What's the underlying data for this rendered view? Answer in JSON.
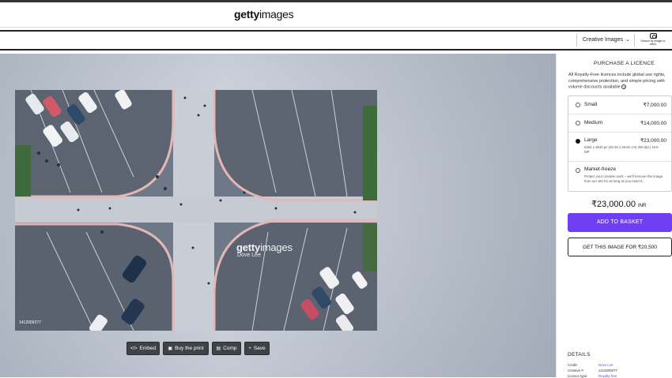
{
  "brand": {
    "logo_bold": "getty",
    "logo_rest": "images"
  },
  "search": {
    "value": "",
    "placeholder": ""
  },
  "nav": {
    "creative_dropdown": "Creative Images",
    "search_by_image": "Search by image or video"
  },
  "photo": {
    "id_text": "1412009277",
    "watermark_bold": "getty",
    "watermark_rest": "images",
    "watermark_credit": "Dove Lee"
  },
  "actions": [
    {
      "label": "Embed",
      "icon": "code-icon"
    },
    {
      "label": "Buy the print",
      "icon": "image-icon"
    },
    {
      "label": "Comp",
      "icon": "save-icon"
    },
    {
      "label": "Save",
      "icon": "plus-icon"
    }
  ],
  "licence": {
    "title": "PURCHASE A LICENCE",
    "description": "All Royalty-Free licences include global use rights, comprehensive protection, and simple pricing with volume discounts available",
    "options": [
      {
        "name": "Small",
        "price": "₹7,000.00",
        "selected": false,
        "sub": ""
      },
      {
        "name": "Medium",
        "price": "₹14,000.00",
        "selected": false,
        "sub": ""
      },
      {
        "name": "Large",
        "price": "₹23,000.00",
        "selected": true,
        "sub": "5464 x 3640 px (46.26 x 30.82 cm) 300 dpi | 19.9 MP"
      },
      {
        "name": "Market-freeze",
        "price": "",
        "selected": false,
        "sub": "Protect your creative work – we'll remove this image from our site for as long as you need it."
      }
    ],
    "total": "₹23,000.00",
    "currency": "INR",
    "add_label": "ADD TO BASKET",
    "get_label": "GET THIS IMAGE FOR ₹20,500"
  },
  "details": {
    "title": "DETAILS",
    "rows": [
      {
        "label": "Credit:",
        "value": "Dove Lee",
        "link": true
      },
      {
        "label": "Creative #:",
        "value": "1412009277",
        "link": false
      },
      {
        "label": "Licence type:",
        "value": "Royalty-free",
        "link": true
      }
    ]
  },
  "colors": {
    "accent": "#6e3ff3",
    "action_button": "#3f4247"
  }
}
